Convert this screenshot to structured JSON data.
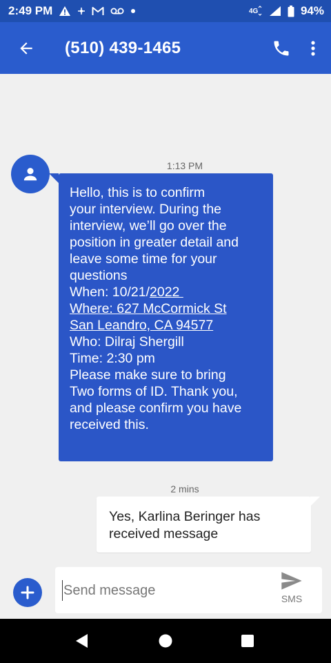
{
  "status_bar": {
    "time": "2:49 PM",
    "battery": "94%",
    "network_label": "4G",
    "icons": [
      "warning-icon",
      "cross-icon",
      "gmail-icon",
      "voicemail-icon",
      "dot-icon",
      "network-4g-icon",
      "signal-icon",
      "battery-icon"
    ]
  },
  "app_bar": {
    "title": "(510) 439-1465",
    "icons": [
      "back-arrow-icon",
      "phone-icon",
      "more-vert-icon"
    ]
  },
  "conversation": {
    "incoming": {
      "timestamp": "1:13 PM",
      "lines": [
        "Hello, this is to confirm",
        "your interview. During the",
        "interview, we’ll go over the",
        "position in greater detail and",
        "leave some time for your",
        "questions",
        "When: 10/21/",
        "2022 ",
        "Where: 627 McCormick St",
        "San Leandro, CA 94577",
        "Who: Dilraj Shergill",
        "Time: 2:30 pm",
        "Please make sure to bring",
        "Two forms of ID. Thank you,",
        "and please confirm you have",
        "received this."
      ]
    },
    "outgoing": {
      "timestamp": "2 mins",
      "lines": [
        "Yes, Karlina Beringer has",
        "received message"
      ]
    }
  },
  "compose": {
    "placeholder": "Send message",
    "value": "",
    "send_label": "SMS"
  },
  "colors": {
    "primary": "#2a5ccd",
    "status_bar": "#1f4fb0",
    "incoming_bubble": "#2b56c7",
    "outgoing_bubble": "#ffffff",
    "background": "#f0f0f0"
  }
}
